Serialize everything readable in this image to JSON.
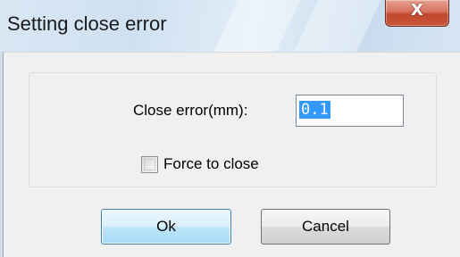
{
  "window": {
    "title": "Setting close error",
    "close_glyph": "X"
  },
  "form": {
    "close_error_label": "Close error(mm):",
    "close_error_value": "0.1",
    "force_close_label": "Force to close",
    "force_close_checked": false
  },
  "buttons": {
    "ok_label": "Ok",
    "cancel_label": "Cancel"
  },
  "icons": {
    "close": "close-icon"
  },
  "colors": {
    "selection": "#3399ff",
    "default_button_border": "#3c7fb1",
    "close_button": "#c9563c"
  }
}
